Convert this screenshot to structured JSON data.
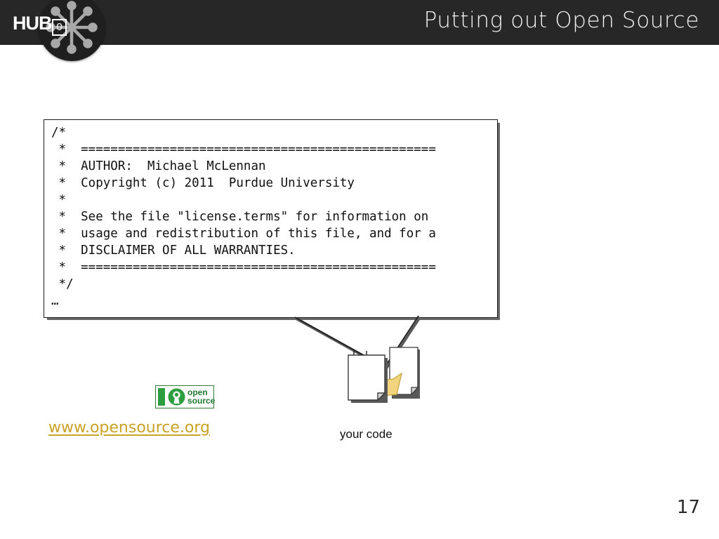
{
  "slide": {
    "page_number": "17",
    "background_color": "#ffffff"
  },
  "header": {
    "title": "Putting out Open Source",
    "background_color": "#272727",
    "title_color": "#f2f2f2",
    "logo": {
      "wordmark": "HUB",
      "zero_glyph": "0",
      "badge_color": "#1f1f1f",
      "node_color": "#a8a8a8",
      "icon_name": "hub-zero-radial-nodes"
    }
  },
  "code_callout": {
    "border_color": "#1c1c1c",
    "shadow_color": "#5a5a5a",
    "text": "/*\n *  ================================================\n *  AUTHOR:  Michael McLennan\n *  Copyright (c) 2011  Purdue University\n *\n *  See the file \"license.terms\" for information on\n *  usage and redistribution of this file, and for a\n *  DISCLAIMER OF ALL WARRANTIES.\n *  ================================================\n */\n…",
    "lines": [
      "/*",
      " *  ================================================",
      " *  AUTHOR:  Michael McLennan",
      " *  Copyright (c) 2011  Purdue University",
      " *",
      " *  See the file \"license.terms\" for information on",
      " *  usage and redistribution of this file, and for a",
      " *  DISCLAIMER OF ALL WARRANTIES.",
      " *  ================================================",
      " */",
      "…"
    ],
    "author": "Michael McLennan",
    "copyright": "Copyright (c) 2011  Purdue University",
    "license_file": "license.terms",
    "disclaimer": "DISCLAIMER OF ALL WARRANTIES."
  },
  "code_docs": {
    "label": "your code",
    "document_color": "#ffffff",
    "folder_color": "#f2d47e",
    "outline_color": "#3a3a3a"
  },
  "open_source": {
    "logo_alt": "open source",
    "line1": "open",
    "line2": "source",
    "trademark": "™",
    "logo_green": "#2c9e3f",
    "url": "www.opensource.org",
    "url_color": "#c9a227"
  }
}
